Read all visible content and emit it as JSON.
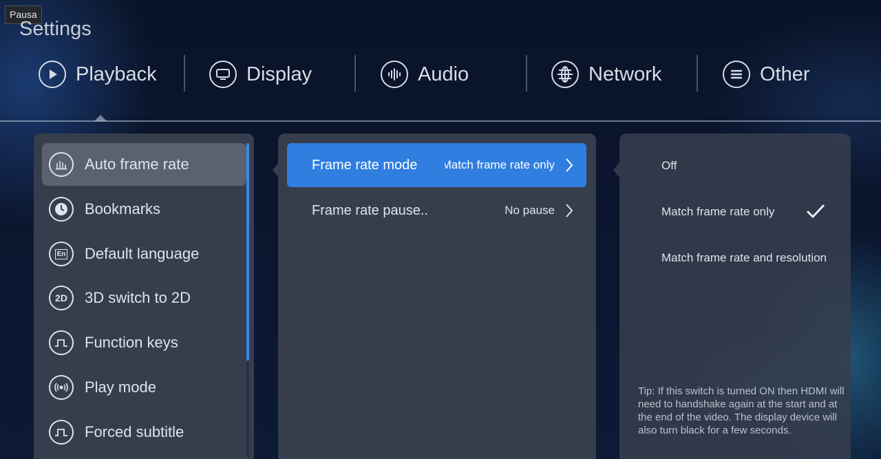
{
  "tooltip": "Pausa",
  "title": "Settings",
  "tabs": [
    {
      "label": "Playback",
      "icon": "play-icon"
    },
    {
      "label": "Display",
      "icon": "monitor-icon"
    },
    {
      "label": "Audio",
      "icon": "audio-wave-icon"
    },
    {
      "label": "Network",
      "icon": "globe-icon"
    },
    {
      "label": "Other",
      "icon": "menu-icon"
    }
  ],
  "left_menu": [
    {
      "label": "Auto frame rate",
      "icon": "bar-chart-icon",
      "selected": true
    },
    {
      "label": "Bookmarks",
      "icon": "clock-icon"
    },
    {
      "label": "Default language",
      "icon": "language-icon",
      "glyph": "En"
    },
    {
      "label": "3D switch to 2D",
      "icon": "2d-icon",
      "glyph": "2D"
    },
    {
      "label": "Function keys",
      "icon": "pulse-icon"
    },
    {
      "label": "Play mode",
      "icon": "broadcast-icon"
    },
    {
      "label": "Forced subtitle",
      "icon": "pulse-icon"
    }
  ],
  "mid_rows": [
    {
      "label": "Frame rate mode",
      "value": "Match frame rate only",
      "selected": true
    },
    {
      "label": "Frame rate pause..",
      "value": "No pause"
    }
  ],
  "options": [
    {
      "label": "Off"
    },
    {
      "label": "Match frame rate only",
      "checked": true
    },
    {
      "label": "Match frame rate and resolution"
    }
  ],
  "tip": "Tip: If this switch is turned ON then HDMI will need to handshake again at the start and at the end of the video. The display device will also turn black for a few seconds.",
  "colors": {
    "accent": "#2f7ee0",
    "panel": "#363e4d",
    "selected_item": "#5a6170"
  }
}
